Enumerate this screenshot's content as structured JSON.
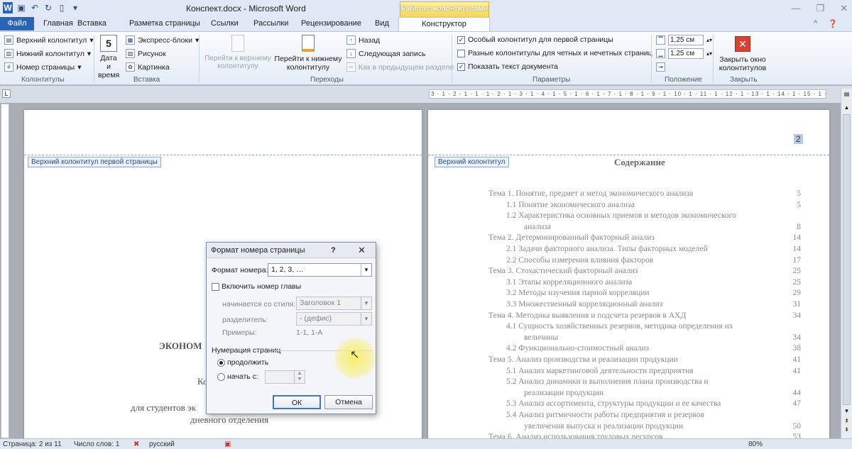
{
  "window": {
    "title": "Конспект.docx - Microsoft Word",
    "context_tab_group": "Работа с колонтитулами"
  },
  "tabs": {
    "file": "Файл",
    "items": [
      "Главная",
      "Вставка",
      "Разметка страницы",
      "Ссылки",
      "Рассылки",
      "Рецензирование",
      "Вид"
    ],
    "active": "Конструктор"
  },
  "ribbon": {
    "kolontituly": {
      "header": "Верхний колонтитул",
      "footer": "Нижний колонтитул",
      "page_number": "Номер страницы",
      "label": "Колонтитулы"
    },
    "insert": {
      "date_time_line1": "Дата и",
      "date_time_line2": "время",
      "express": "Экспресс-блоки",
      "picture": "Рисунок",
      "clipart": "Картинка",
      "label": "Вставка"
    },
    "nav": {
      "go_header_1": "Перейти к верхнему",
      "go_header_2": "колонтитулу",
      "go_footer_1": "Перейти к нижнему",
      "go_footer_2": "колонтитулу",
      "back": "Назад",
      "next": "Следующая запись",
      "link_prev": "Как в предыдущем разделе",
      "label": "Переходы"
    },
    "params": {
      "first_page": "Особый колонтитул для первой страницы",
      "odd_even": "Разные колонтитулы для четных и нечетных страниц",
      "show_text": "Показать текст документа",
      "first_page_checked": "✓",
      "show_text_checked": "✓",
      "label": "Параметры"
    },
    "position": {
      "top_value": "1,25 см",
      "bottom_value": "1,25 см",
      "label": "Положение"
    },
    "close": {
      "line1": "Закрыть окно",
      "line2": "колонтитулов",
      "label": "Закрыть"
    }
  },
  "ruler": {
    "marks": "3 · 1 · 2 · 1 · 1 · 1 · 2 · 1 · 3 · 1 · 4 · 1 · 5 · 1 · 6 · 1 · 7 · 1 · 8 · 1 · 9 · 1 · 10 · 1 · 11 · 1 · 12 · 1 · 13 · 1 · 14 · 1 · 15 · 1 · 16 · 17 ·"
  },
  "page1": {
    "header_tag": "Верхний колонтитул первой страницы",
    "line1": "ЭКОНОМ",
    "line2": "Ко",
    "line3": "для студентов эк",
    "line4": "дневного отделения"
  },
  "page2": {
    "header_tag": "Верхний колонтитул",
    "page_number": "2",
    "toc_title": "Содержание",
    "toc": [
      {
        "text": "Тема 1. Понятие, предмет и метод экономического анализа",
        "page": "5",
        "indent": 0
      },
      {
        "text": "1.1   Понятие экономического анализа",
        "page": "5",
        "indent": 1
      },
      {
        "text": "1.2   Характеристика основных приемов и методов экономического",
        "page": "",
        "indent": 1
      },
      {
        "text": "анализа",
        "page": "8",
        "indent": 2
      },
      {
        "text": "Тема 2. Детерминированный факторный анализ",
        "page": "14",
        "indent": 0
      },
      {
        "text": "2.1   Задачи факторного анализа. Типы факторных моделей",
        "page": "14",
        "indent": 1
      },
      {
        "text": "2.2   Способы измерения влияния факторов",
        "page": "17",
        "indent": 1
      },
      {
        "text": "Тема 3. Стохастический факторный анализ",
        "page": "25",
        "indent": 0
      },
      {
        "text": "3.1   Этапы корреляционного анализа",
        "page": "25",
        "indent": 1
      },
      {
        "text": "3.2   Методы изучения парной корреляции",
        "page": "29",
        "indent": 1
      },
      {
        "text": "3.3   Множественный корреляционный анализ",
        "page": "31",
        "indent": 1
      },
      {
        "text": "Тема 4. Методика выявления и подсчета резервов в АХД",
        "page": "34",
        "indent": 0
      },
      {
        "text": "4.1   Сущность хозяйственных резервов, методика определения их",
        "page": "",
        "indent": 1
      },
      {
        "text": "величины",
        "page": "34",
        "indent": 2
      },
      {
        "text": "4.2   Функционально-стоимостный анализ",
        "page": "38",
        "indent": 1
      },
      {
        "text": "Тема 5. Анализ производства и реализации продукции",
        "page": "41",
        "indent": 0
      },
      {
        "text": "5.1   Анализ маркетинговой деятельности предприятия",
        "page": "41",
        "indent": 1
      },
      {
        "text": "5.2   Анализ динамики и выполнения плана производства и",
        "page": "",
        "indent": 1
      },
      {
        "text": "реализации продукции",
        "page": "44",
        "indent": 2
      },
      {
        "text": "5.3   Анализ ассортимента, структуры продукции и ее качества",
        "page": "47",
        "indent": 1
      },
      {
        "text": "5.4   Анализ ритмичности работы предприятия и резервов",
        "page": "",
        "indent": 1
      },
      {
        "text": "увеличения выпуска и реализации продукции",
        "page": "50",
        "indent": 2
      },
      {
        "text": "Тема 6. Анализ использования трудовых ресурсов",
        "page": "53",
        "indent": 0
      }
    ]
  },
  "dialog": {
    "title": "Формат номера страницы",
    "help": "?",
    "close": "✕",
    "format_label": "Формат номера:",
    "format_value": "1, 2, 3, …",
    "include_chapter": "Включить номер главы",
    "starts_with_label": "начинается со стиля:",
    "starts_with_value": "Заголовок 1",
    "separator_label": "разделитель:",
    "separator_value": "-   (дефис)",
    "examples_label": "Примеры:",
    "examples_value": "1-1, 1-А",
    "numbering_group": "Нумерация страниц",
    "continue": "продолжить",
    "start_at": "начать с:",
    "ok": "ОК",
    "cancel": "Отмена"
  },
  "status": {
    "page": "Страница: 2 из 11",
    "words": "Число слов: 1",
    "language": "русский",
    "zoom": "80%"
  }
}
